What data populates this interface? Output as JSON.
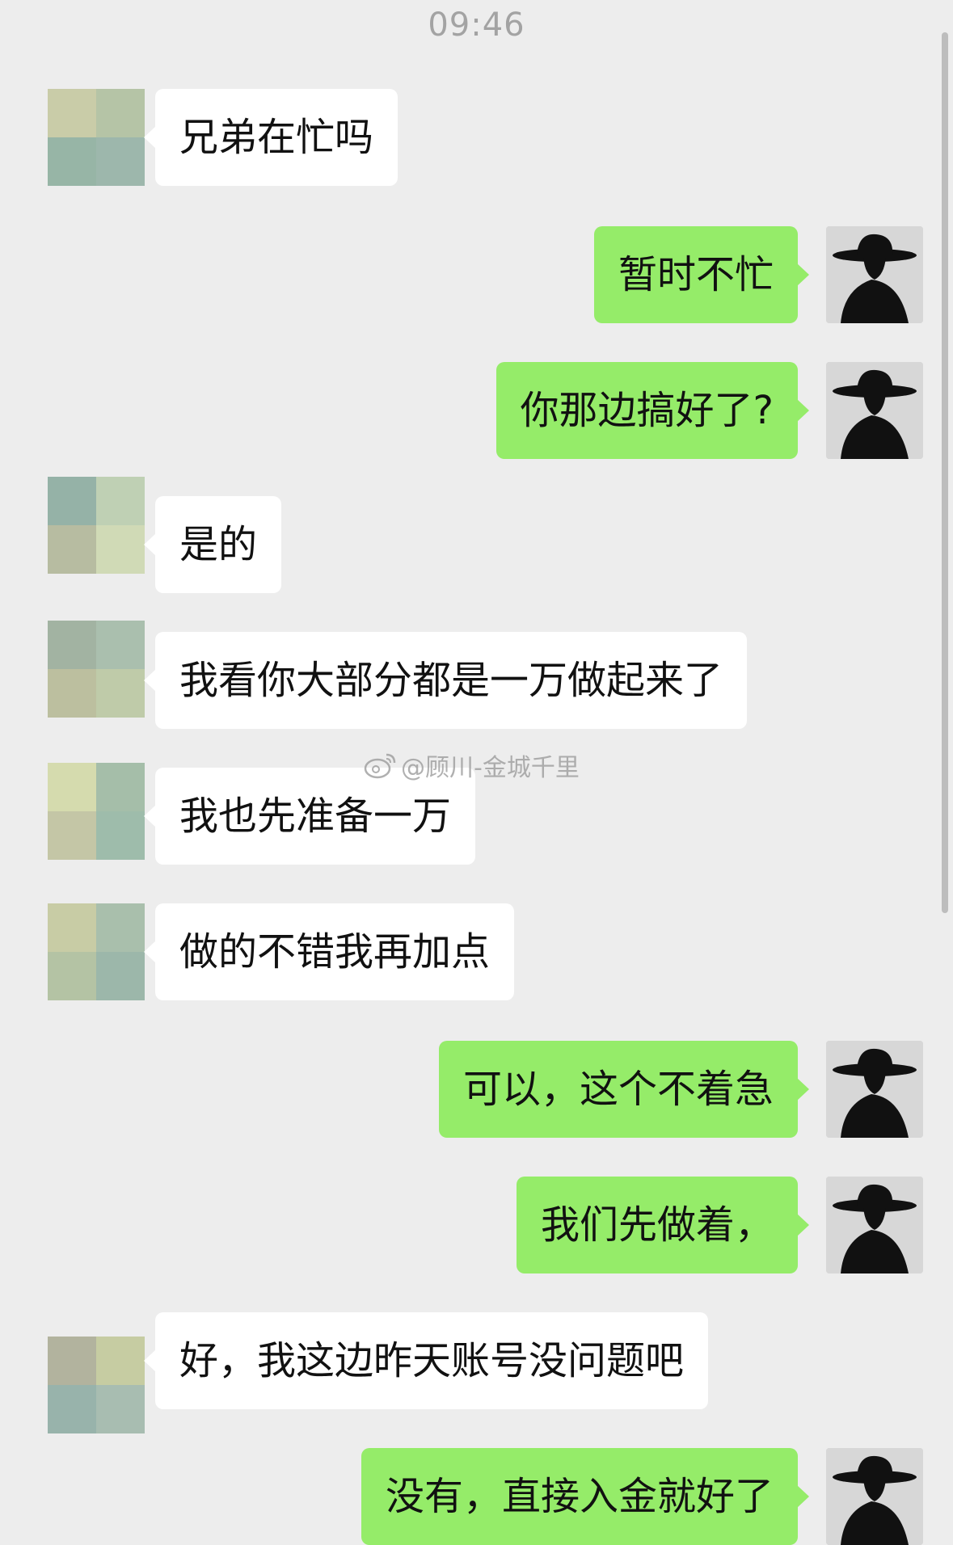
{
  "chat": {
    "time": "09:46",
    "watermark": "@顾川-金城千里",
    "me_avatar_icon": "silhouette-hat-avatar-icon",
    "other_avatar_icon": "mosaic-blurred-avatar-icon",
    "colors": {
      "background": "#ededed",
      "sent_bubble": "#95ec69",
      "received_bubble": "#ffffff"
    },
    "messages": [
      {
        "side": "left",
        "text": "兄弟在忙吗"
      },
      {
        "side": "right",
        "text": "暂时不忙"
      },
      {
        "side": "right",
        "text": "你那边搞好了?"
      },
      {
        "side": "left",
        "text": "是的"
      },
      {
        "side": "left",
        "text": "我看你大部分都是一万做起来了"
      },
      {
        "side": "left",
        "text": "我也先准备一万"
      },
      {
        "side": "left",
        "text": "做的不错我再加点"
      },
      {
        "side": "right",
        "text": "可以，这个不着急"
      },
      {
        "side": "right",
        "text": "我们先做着，"
      },
      {
        "side": "left",
        "text": "好，我这边昨天账号没问题吧"
      },
      {
        "side": "right",
        "text": "没有，直接入金就好了"
      }
    ]
  }
}
